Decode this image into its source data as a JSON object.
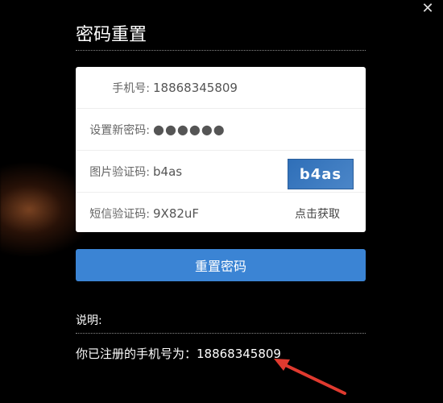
{
  "dialog": {
    "title": "密码重置",
    "close_icon": "close-icon"
  },
  "form": {
    "phone": {
      "label": "手机号:",
      "value": "18868345809"
    },
    "new_password": {
      "label": "设置新密码:",
      "value": "●●●●●●"
    },
    "image_captcha": {
      "label": "图片验证码:",
      "value": "b4as",
      "captcha_text": "b4as"
    },
    "sms_code": {
      "label": "短信验证码:",
      "value": "9X82uF",
      "get_code_label": "点击获取"
    }
  },
  "actions": {
    "reset_button_label": "重置密码"
  },
  "notes": {
    "label": "说明:",
    "text": "你已注册的手机号为：18868345809"
  },
  "colors": {
    "accent": "#3b84d4",
    "background": "#000000"
  }
}
